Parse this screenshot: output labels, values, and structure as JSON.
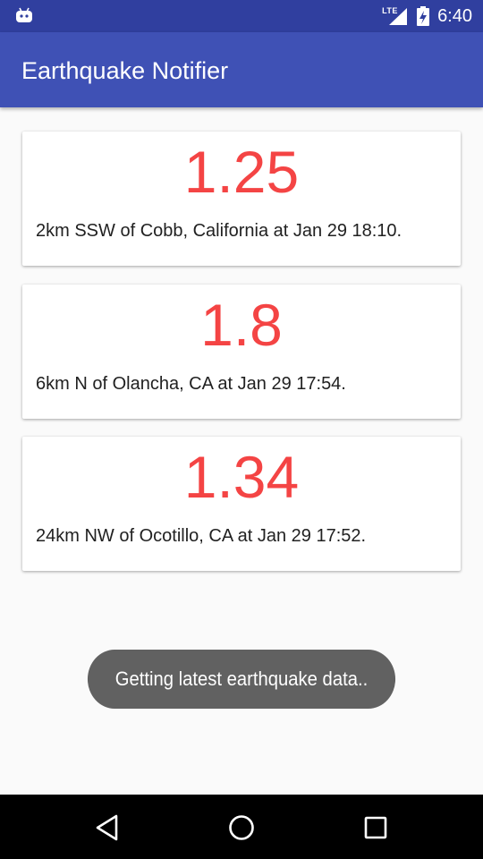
{
  "status_bar": {
    "left_icon": "android-debug-icon",
    "network_label": "LTE",
    "signal_icon": "signal-icon",
    "battery_icon": "battery-charging-icon",
    "time": "6:40",
    "color": "#303f9f"
  },
  "app_bar": {
    "title": "Earthquake Notifier",
    "color": "#3f51b5"
  },
  "earthquakes": [
    {
      "magnitude": "1.25",
      "description": "2km SSW of Cobb, California at Jan 29 18:10."
    },
    {
      "magnitude": "1.8",
      "description": "6km N of Olancha, CA at Jan 29 17:54."
    },
    {
      "magnitude": "1.34",
      "description": "24km NW of Ocotillo, CA at Jan 29 17:52."
    }
  ],
  "magnitude_color": "#f44444",
  "toast": {
    "message": "Getting latest earthquake data.."
  },
  "nav_bar": {
    "back_icon": "back-triangle-icon",
    "home_icon": "home-circle-icon",
    "recents_icon": "recents-square-icon"
  }
}
